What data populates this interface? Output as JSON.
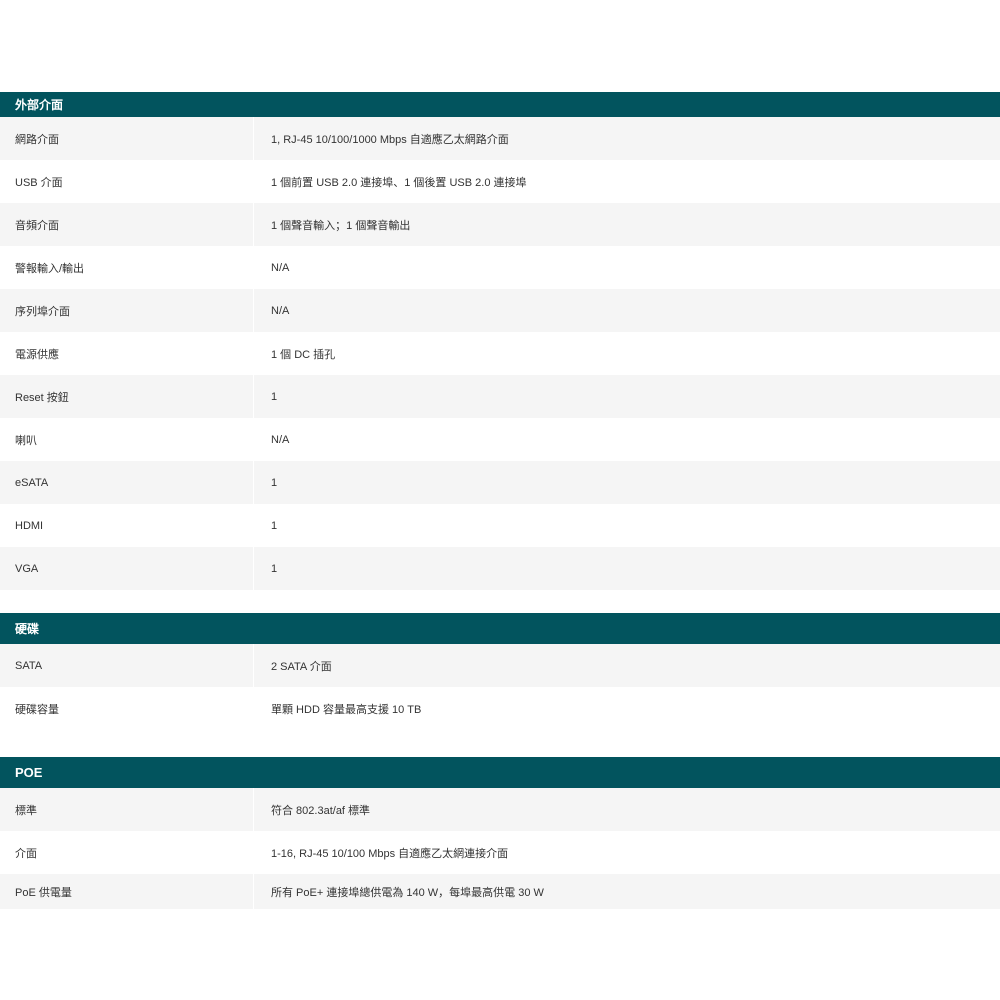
{
  "sections": [
    {
      "title": "外部介面",
      "rows": [
        {
          "label": "網路介面",
          "value": "1, RJ-45 10/100/1000 Mbps 自適應乙太網路介面"
        },
        {
          "label": "USB 介面",
          "value": "1 個前置 USB 2.0 連接埠、1 個後置 USB 2.0 連接埠"
        },
        {
          "label": "音頻介面",
          "value": "1 個聲音輸入；1 個聲音輸出"
        },
        {
          "label": "警報輸入/輸出",
          "value": "N/A"
        },
        {
          "label": "序列埠介面",
          "value": "N/A"
        },
        {
          "label": "電源供應",
          "value": "1 個 DC 插孔"
        },
        {
          "label": "Reset 按鈕",
          "value": "1"
        },
        {
          "label": "喇叭",
          "value": "N/A"
        },
        {
          "label": "eSATA",
          "value": "1"
        },
        {
          "label": "HDMI",
          "value": "1"
        },
        {
          "label": "VGA",
          "value": "1"
        }
      ]
    },
    {
      "title": "硬碟",
      "rows": [
        {
          "label": "SATA",
          "value": "2 SATA 介面"
        },
        {
          "label": "硬碟容量",
          "value": "單顆 HDD 容量最高支援 10 TB"
        }
      ]
    },
    {
      "title": "POE",
      "rows": [
        {
          "label": "標準",
          "value": "符合 802.3at/af 標準"
        },
        {
          "label": "介面",
          "value": "1-16, RJ-45 10/100 Mbps 自適應乙太網連接介面"
        },
        {
          "label": "PoE 供電量",
          "value": "所有 PoE+ 連接埠總供電為 140 W，每埠最高供電 30 W"
        }
      ]
    }
  ]
}
